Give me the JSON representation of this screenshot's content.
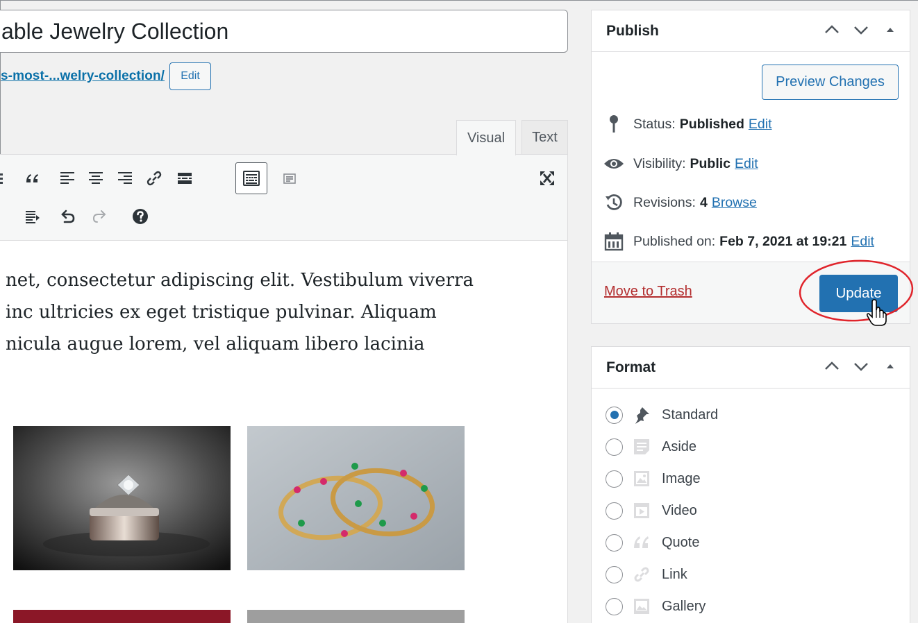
{
  "post": {
    "title": "able Jewelry Collection",
    "permalink": "s-most-...welry-collection/",
    "permalink_edit": "Edit"
  },
  "editor": {
    "tabs": {
      "visual": "Visual",
      "text": "Text"
    },
    "toolbar_icons": [
      "blockquote-icon",
      "align-left-icon",
      "align-center-icon",
      "align-right-icon",
      "link-icon",
      "read-more-icon",
      "toolbar-toggle-icon",
      "add-media-icon",
      "fullscreen-icon",
      "paste-text-icon",
      "undo-icon",
      "redo-icon",
      "help-icon"
    ],
    "content_lines": [
      "net, consectetur adipiscing elit. Vestibulum viverra",
      "inc ultricies ex eget tristique pulvinar. Aliquam",
      "nicula augue lorem, vel aliquam libero lacinia"
    ]
  },
  "publish": {
    "title": "Publish",
    "preview_label": "Preview Changes",
    "status_label": "Status:",
    "status_value": "Published",
    "status_edit": "Edit",
    "visibility_label": "Visibility:",
    "visibility_value": "Public",
    "visibility_edit": "Edit",
    "revisions_label": "Revisions:",
    "revisions_value": "4",
    "revisions_browse": "Browse",
    "published_label": "Published on:",
    "published_value": "Feb 7, 2021 at 19:21",
    "published_edit": "Edit",
    "trash_label": "Move to Trash",
    "update_label": "Update"
  },
  "format": {
    "title": "Format",
    "selected": "Standard",
    "options": [
      "Standard",
      "Aside",
      "Image",
      "Video",
      "Quote",
      "Link",
      "Gallery"
    ]
  },
  "colors": {
    "primary": "#2271b1",
    "danger": "#b32d2e",
    "highlight": "#e0242b"
  }
}
